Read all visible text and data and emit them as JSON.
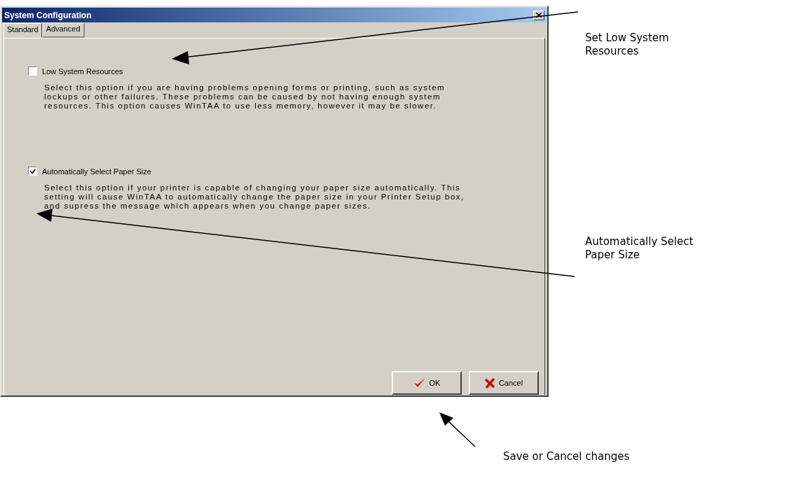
{
  "window": {
    "title": "System Configuration"
  },
  "tabs": [
    {
      "label": "Standard",
      "selected": false
    },
    {
      "label": "Advanced",
      "selected": true
    }
  ],
  "options": [
    {
      "label": "Low System Resources",
      "checked": false,
      "description": "Select this option if you are having problems opening forms or printing, such as system lockups or other failures. These problems can be caused by not having enough system resources. This option causes WinTAA to use less memory, however it may be slower."
    },
    {
      "label": "Automatically Select Paper Size",
      "checked": true,
      "description": "Select this option if your printer is capable of changing your paper size automatically. This setting will cause WinTAA to automatically change the paper size in your Printer Setup box, and supress the message which appears when you change paper sizes."
    }
  ],
  "buttons": [
    {
      "label": "OK",
      "kind": "ok"
    },
    {
      "label": "Cancel",
      "kind": "cancel"
    }
  ],
  "annotations": [
    {
      "text": "Set Low System Resources"
    },
    {
      "text": "Automatically Select Paper Size"
    },
    {
      "text": "Save or Cancel changes"
    }
  ]
}
